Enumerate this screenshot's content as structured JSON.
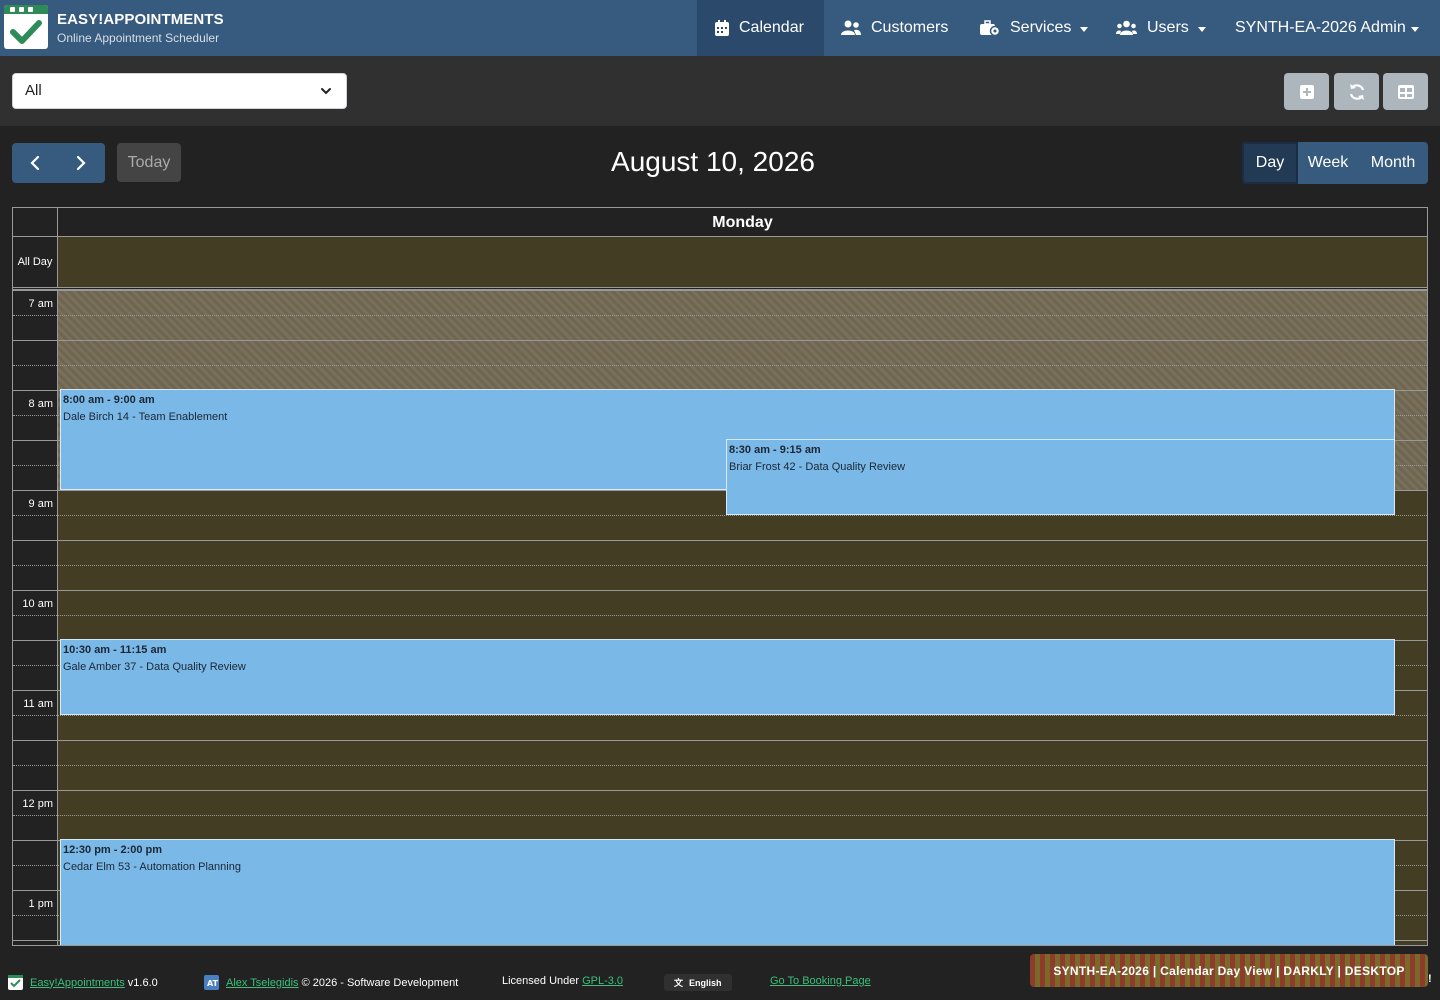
{
  "brand": {
    "title": "EASY!APPOINTMENTS",
    "subtitle": "Online Appointment Scheduler",
    "logo_icon": "check-logo-icon"
  },
  "nav": {
    "calendar": "Calendar",
    "customers": "Customers",
    "services": "Services",
    "users": "Users",
    "account": "SYNTH-EA-2026 Admin"
  },
  "toolbar": {
    "filter_value": "All",
    "buttons": [
      "add-appointment-icon",
      "reload-icon",
      "table-view-icon"
    ]
  },
  "calendar": {
    "title": "August 10, 2026",
    "today_label": "Today",
    "views": {
      "day": "Day",
      "week": "Week",
      "month": "Month",
      "active": "Day"
    },
    "day_header": "Monday",
    "all_day_label": "All Day",
    "hour_labels": [
      "7 am",
      "8 am",
      "9 am",
      "10 am",
      "11 am",
      "12 pm",
      "1 pm"
    ],
    "events": [
      {
        "time": "8:00 am - 9:00 am",
        "desc": "Dale Birch 14 - Team Enablement"
      },
      {
        "time": "8:30 am - 9:15 am",
        "desc": "Briar Frost 42 - Data Quality Review"
      },
      {
        "time": "10:30 am - 11:15 am",
        "desc": "Gale Amber 37 - Data Quality Review"
      },
      {
        "time": "12:30 pm - 2:00 pm",
        "desc": "Cedar Elm 53 - Automation Planning"
      }
    ],
    "event_color": "#7ab8e8",
    "unavailable_range": "7 am - 9 am"
  },
  "footer": {
    "app_link": "Easy!Appointments",
    "version": "v1.6.0",
    "author_link": "Alex Tselegidis",
    "copyright": "© 2026 - Software Development",
    "license_prefix": "Licensed Under",
    "license_link": "GPL-3.0",
    "language": "English",
    "booking_link": "Go To Booking Page",
    "banner": "SYNTH-EA-2026 | Calendar Day View | DARKLY | DESKTOP"
  },
  "colors": {
    "navbar": "#375a7f",
    "background": "#222222",
    "calendar_body": "#433d23",
    "accent_green": "#3bbf7a"
  }
}
